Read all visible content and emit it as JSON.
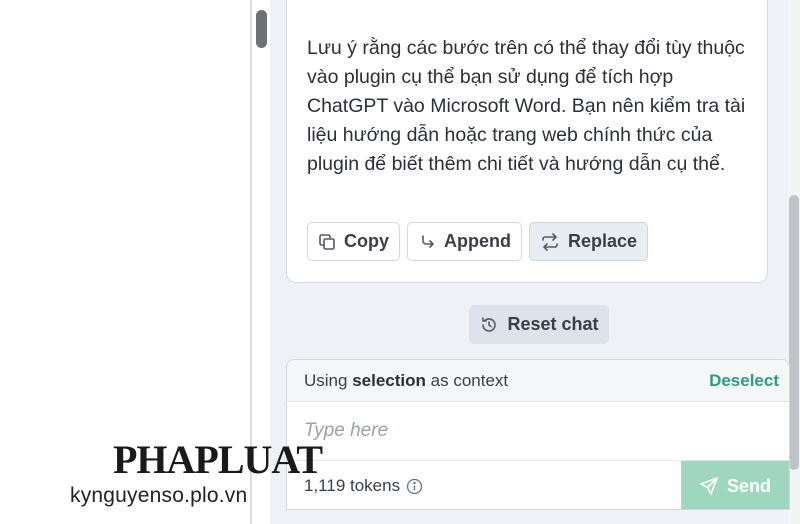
{
  "message": {
    "text": "Lưu ý rằng các bước trên có thể thay đổi tùy thuộc vào plugin cụ thể bạn sử dụng để tích hợp ChatGPT vào Microsoft Word. Bạn nên kiểm tra tài liệu hướng dẫn hoặc trang web chính thức của plugin để biết thêm chi tiết và hướng dẫn cụ thể.",
    "actions": {
      "copy": {
        "label": "Copy",
        "icon": "copy-icon"
      },
      "append": {
        "label": "Append",
        "icon": "append-arrow-icon"
      },
      "replace": {
        "label": "Replace",
        "icon": "replace-arrows-icon"
      }
    }
  },
  "reset": {
    "label": "Reset chat",
    "icon": "reset-icon"
  },
  "context": {
    "prefix": "Using",
    "keyword": "selection",
    "suffix": "as context",
    "deselect_label": "Deselect"
  },
  "prompt": {
    "placeholder": "Type here",
    "value": ""
  },
  "footer": {
    "tokens": "1,119 tokens",
    "info_icon": "info-icon",
    "send_label": "Send",
    "send_icon": "send-icon"
  },
  "watermark": {
    "logo_text": "PHAPLUAT",
    "url": "kynguyenso.plo.vn"
  },
  "colors": {
    "accent": "#2a9d7f",
    "send_disabled": "#9ed6bf",
    "sidebar_bg": "#eef1f5"
  }
}
